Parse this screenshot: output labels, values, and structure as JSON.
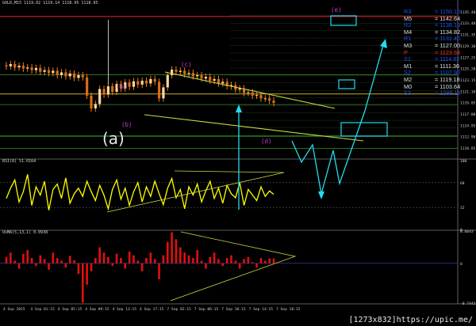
{
  "header": {
    "symbol": "GOLD,M15",
    "ohlc": "1119.02 1119.14 1118.95 1118.95"
  },
  "rsi_label": "RSI(8) 51.0164",
  "osma_label": "OsMA(5,13,1) 0.0938",
  "watermark": "[1273x832]https://upic.me/",
  "big_label": "(a)",
  "wave_labels": {
    "a": "(a)",
    "b": "(b)",
    "c": "(c)",
    "d": "(d)",
    "e": "(e)"
  },
  "pivots": [
    {
      "label": "R3",
      "value": "1150.10",
      "color": "#1e50ff"
    },
    {
      "label": "M5",
      "value": "1142.64",
      "color": "#e0e0e0"
    },
    {
      "label": "R2",
      "value": "1138.18",
      "color": "#1e50ff"
    },
    {
      "label": "M4",
      "value": "1134.82",
      "color": "#e0e0e0"
    },
    {
      "label": "R1",
      "value": "1131.46",
      "color": "#1e50ff"
    },
    {
      "label": "M3",
      "value": "1127.00",
      "color": "#e0e0e0"
    },
    {
      "label": "P",
      "value": "1123.54",
      "color": "#ff2a2a"
    },
    {
      "label": "S1",
      "value": "1114.82",
      "color": "#1e50ff"
    },
    {
      "label": "M1",
      "value": "1111.36",
      "color": "#e0e0e0"
    },
    {
      "label": "S2",
      "value": "1107.90",
      "color": "#1e50ff"
    },
    {
      "label": "M2",
      "value": "1119.18",
      "color": "#e0e0e0"
    },
    {
      "label": "M0",
      "value": "1103.64",
      "color": "#e0e0e0"
    },
    {
      "label": "S3",
      "value": "1098.18",
      "color": "#1e50ff"
    }
  ],
  "colors": {
    "price": "#ff8c1a",
    "rsi": "#ffff00",
    "osma": "#e01010",
    "trend": "#c8d840",
    "forecast": "#22ddee",
    "text": "#d8d8d8"
  },
  "chart_data": [
    {
      "type": "candlestick",
      "title": "GOLD,M15",
      "ylim": [
        1109,
        1137
      ],
      "y_ticks": [
        "1135.40",
        "1133.40",
        "1131.35",
        "1129.30",
        "1127.25",
        "1125.20",
        "1123.15",
        "1121.10",
        "1119.05",
        "1117.00",
        "1114.95",
        "1112.90",
        "1110.85"
      ],
      "close_series": [
        1125.6,
        1126.0,
        1125.4,
        1125.7,
        1125.2,
        1125.4,
        1124.9,
        1125.3,
        1124.6,
        1124.9,
        1124.4,
        1124.8,
        1124.0,
        1124.5,
        1123.8,
        1124.3,
        1123.5,
        1124.0,
        1123.6,
        1120.3,
        1118.0,
        1118.8,
        1121.5,
        1120.5,
        1122.0,
        1121.0,
        1122.4,
        1121.6,
        1122.7,
        1121.9,
        1122.9,
        1122.3,
        1123.0,
        1122.5,
        1123.3,
        1122.8,
        1119.8,
        1121.8,
        1124.0,
        1125.0,
        1124.6,
        1124.8,
        1124.2,
        1124.4,
        1123.8,
        1124.0,
        1123.4,
        1123.7,
        1123.0,
        1123.3,
        1122.5,
        1122.8,
        1122.0,
        1122.2,
        1121.4,
        1121.6,
        1120.8,
        1120.9,
        1120.3,
        1120.4,
        1119.8,
        1119.8,
        1119.4,
        1119.0
      ],
      "spike_high": 1134.0,
      "x_labels": [
        "4 Sep 2015",
        "4 Sep 01:15",
        "4 Sep 05:15",
        "4 Sep 09:15",
        "4 Sep 13:15",
        "4 Sep 17:15",
        "7 Sep 02:15",
        "7 Sep 06:15",
        "7 Sep 10:15",
        "7 Sep 14:15",
        "7 Sep 18:15"
      ]
    },
    {
      "type": "line",
      "title": "RSI(8) 51.0164",
      "ylim": [
        0,
        100
      ],
      "y_ticks": [
        "100",
        "68",
        "32",
        "0"
      ],
      "values": [
        45,
        60,
        72,
        40,
        55,
        80,
        35,
        62,
        50,
        70,
        28,
        58,
        66,
        45,
        75,
        38,
        52,
        60,
        48,
        70,
        55,
        42,
        64,
        50,
        30,
        58,
        72,
        44,
        60,
        35,
        55,
        68,
        40,
        62,
        48,
        70,
        52,
        36,
        60,
        74,
        46,
        58,
        30,
        62,
        50,
        66,
        40,
        56,
        70,
        45,
        60,
        38,
        64,
        52,
        46,
        68,
        35,
        58,
        50,
        42,
        62,
        48,
        56,
        51
      ]
    },
    {
      "type": "bar",
      "title": "OsMA(5,13,1) 0.0938",
      "ylim": [
        -0.7442,
        0.6043
      ],
      "y_ticks": [
        "0.6043",
        "0",
        "-0.7442"
      ],
      "values": [
        0.12,
        0.2,
        0.05,
        -0.1,
        0.18,
        0.25,
        0.1,
        -0.05,
        0.15,
        0.08,
        -0.12,
        0.2,
        0.1,
        0.05,
        -0.08,
        0.14,
        0.06,
        -0.2,
        -0.74,
        -0.4,
        -0.15,
        0.1,
        0.3,
        0.2,
        0.12,
        -0.05,
        0.18,
        0.1,
        -0.1,
        0.22,
        0.15,
        0.05,
        -0.15,
        0.1,
        0.2,
        0.08,
        -0.3,
        0.15,
        0.4,
        0.58,
        0.45,
        0.3,
        0.2,
        0.15,
        0.1,
        0.25,
        0.05,
        -0.1,
        0.12,
        0.2,
        0.08,
        -0.05,
        0.1,
        0.15,
        0.05,
        -0.1,
        0.08,
        0.12,
        0.02,
        -0.08,
        0.1,
        0.05,
        0.09,
        0.09
      ]
    }
  ]
}
